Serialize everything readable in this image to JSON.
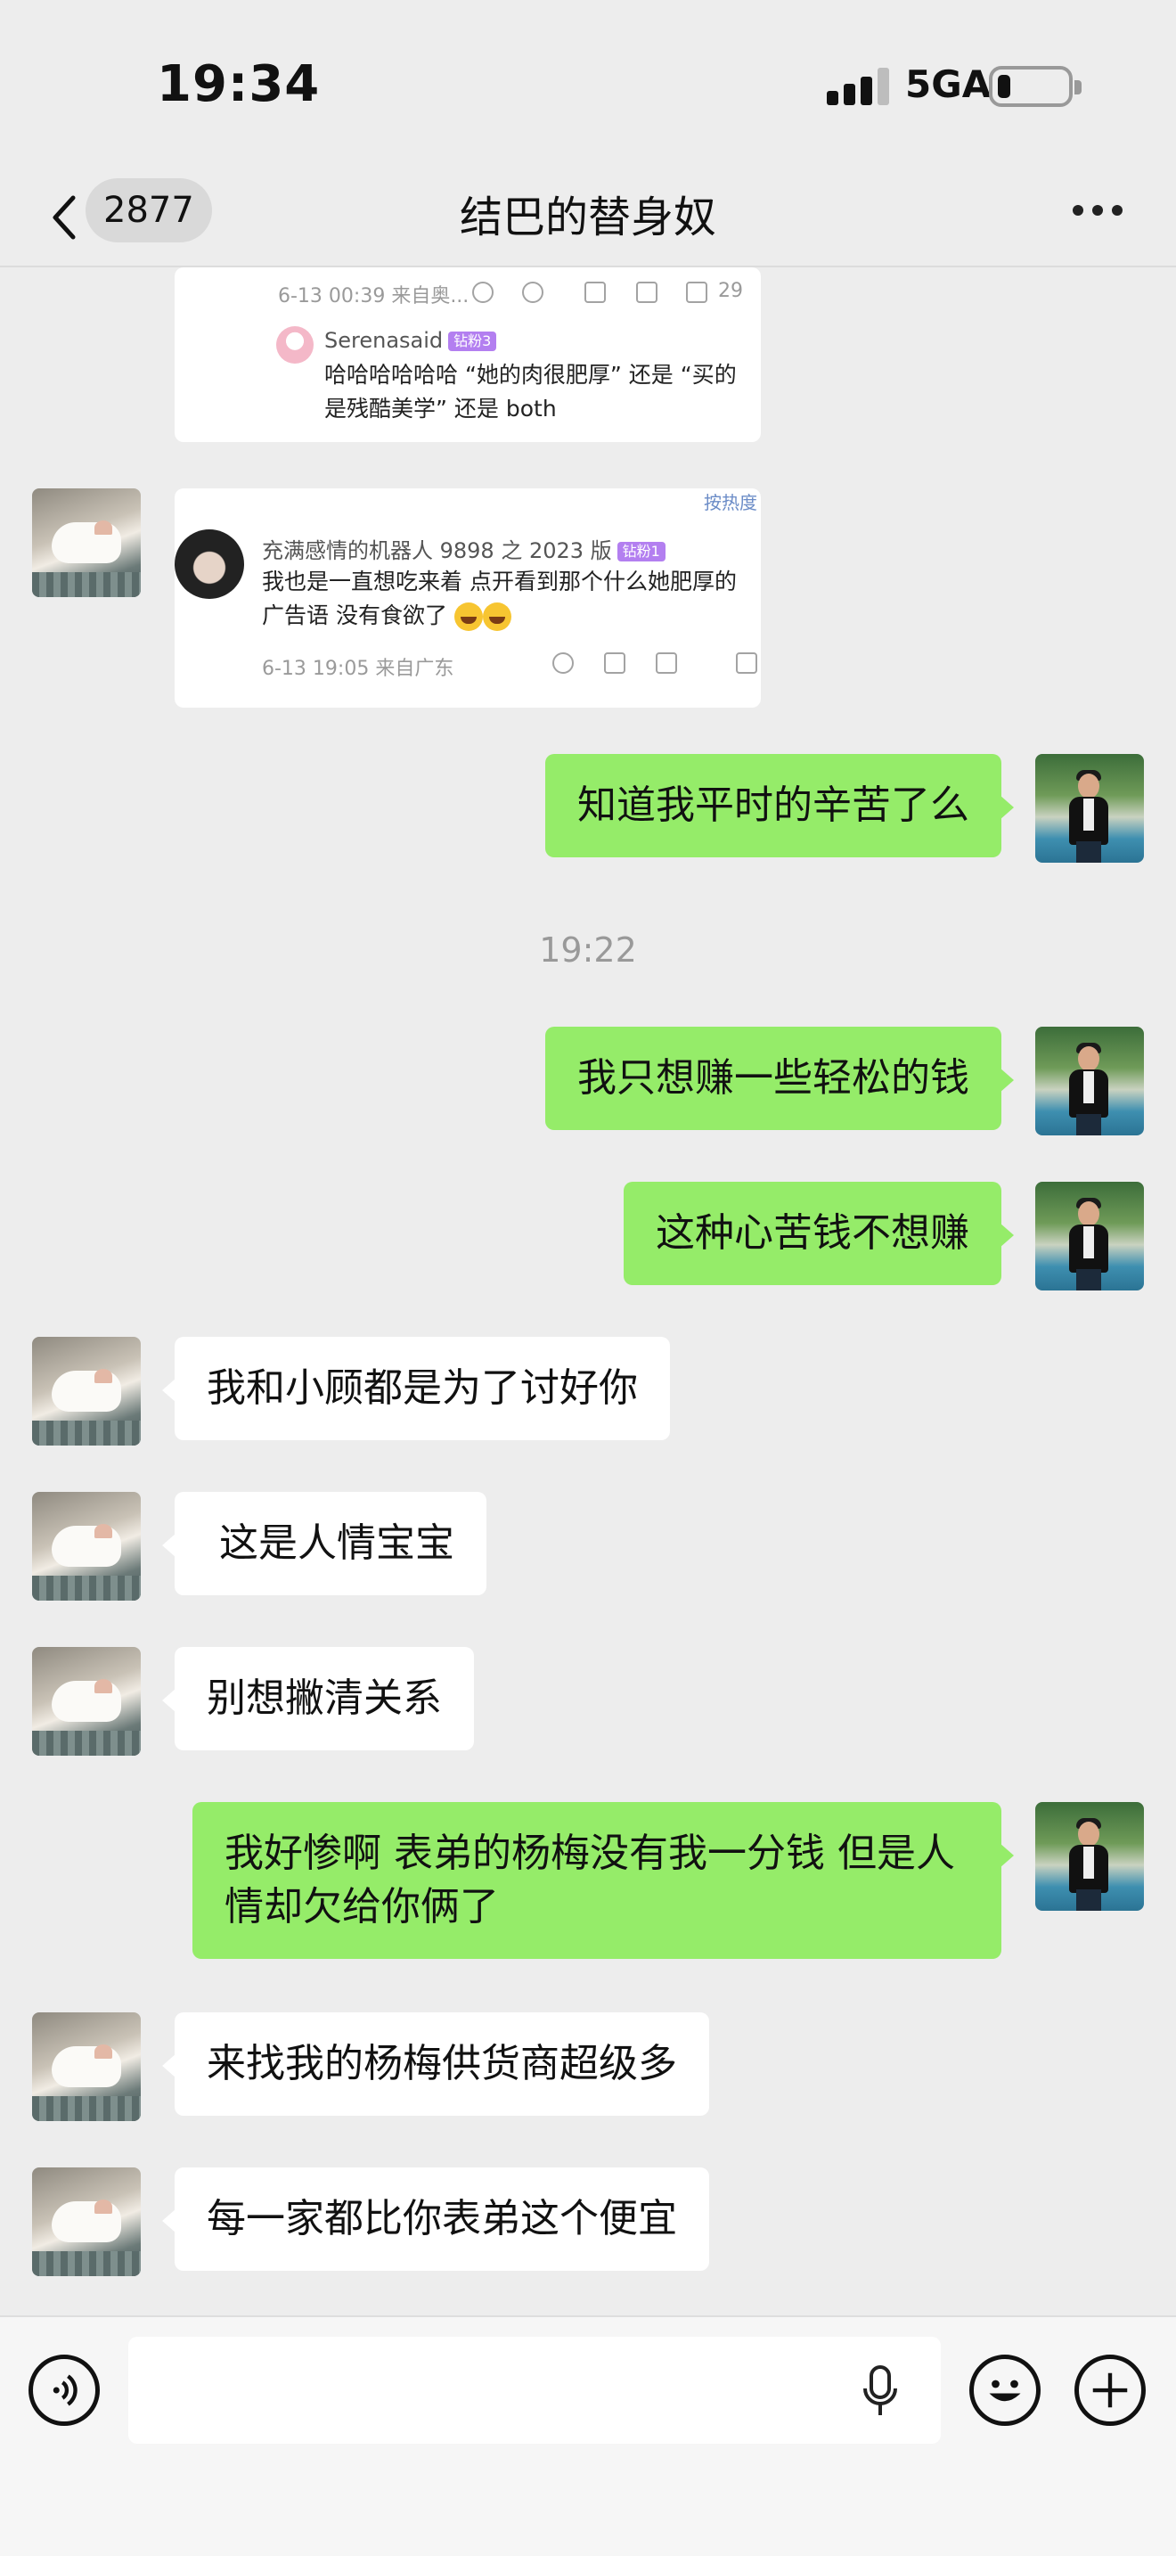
{
  "status_bar": {
    "time": "19:34",
    "network": "5GA"
  },
  "nav": {
    "unread_count": "2877",
    "title": "结巴的替身奴"
  },
  "card1": {
    "meta": "6-13 00:39  来自奥...",
    "like_count": "29",
    "reply_user": "Serenasaid",
    "reply_badge": "钻粉3",
    "reply_text": "哈哈哈哈哈哈 “她的肉很肥厚” 还是 “买的是残酷美学” 还是 both"
  },
  "card2": {
    "sort_label": "按热度",
    "user": "充满感情的机器人 9898 之 2023 版",
    "badge": "钻粉1",
    "comment": "我也是一直想吃来着 点开看到那个什么她肥厚的广告语 没有食欲了",
    "meta": "6-13 19:05  来自广东"
  },
  "messages": {
    "m1": "知道我平时的辛苦了么",
    "time1": "19:22",
    "m2": "我只想赚一些轻松的钱",
    "m3": "这种心苦钱不想赚",
    "m4": "我和小顾都是为了讨好你",
    "m5": " 这是人情宝宝",
    "m6": "别想撇清关系",
    "m7": "我好惨啊 表弟的杨梅没有我一分钱 但是人情却欠给你俩了",
    "m8": "来找我的杨梅供货商超级多",
    "m9": "每一家都比你表弟这个便宜"
  },
  "colors": {
    "sent_bubble": "#95ec69",
    "received_bubble": "#ffffff",
    "background": "#ededed"
  },
  "icons": [
    "back-chevron-icon",
    "more-icon",
    "voice-icon",
    "mic-icon",
    "emoji-icon",
    "plus-icon"
  ]
}
